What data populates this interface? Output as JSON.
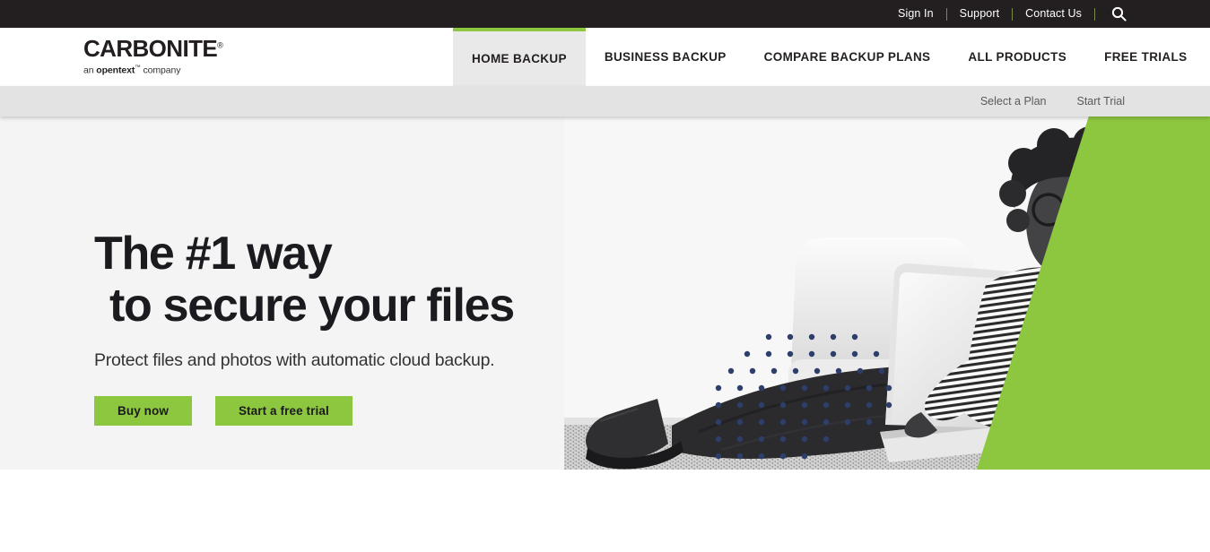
{
  "utility_bar": {
    "links": [
      {
        "label": "Sign In",
        "name": "sign-in-link"
      },
      {
        "label": "Support",
        "name": "support-link"
      },
      {
        "label": "Contact Us",
        "name": "contact-us-link"
      }
    ],
    "search_icon": "search-icon",
    "background_color": "#231f20",
    "separator_color": "#7b8a4a"
  },
  "logo": {
    "wordmark": "CARBONITE",
    "registered_mark": "®",
    "tagline_prefix": "an ",
    "tagline_brand": "opentext",
    "tagline_tm": "™",
    "tagline_suffix": " company"
  },
  "main_nav": {
    "items": [
      {
        "label": "HOME BACKUP",
        "name": "nav-home-backup",
        "active": true
      },
      {
        "label": "BUSINESS BACKUP",
        "name": "nav-business-backup",
        "active": false
      },
      {
        "label": "COMPARE BACKUP PLANS",
        "name": "nav-compare-backup-plans",
        "active": false
      },
      {
        "label": "ALL PRODUCTS",
        "name": "nav-all-products",
        "active": false
      },
      {
        "label": "FREE TRIALS",
        "name": "nav-free-trials",
        "active": false
      }
    ],
    "active_indicator_color": "#8dc63f",
    "active_background": "#e9e9e9"
  },
  "sub_nav": {
    "links": [
      {
        "label": "Select a Plan",
        "name": "select-a-plan-link"
      },
      {
        "label": "Start Trial",
        "name": "start-trial-link"
      }
    ],
    "background_color": "#e3e3e3"
  },
  "hero": {
    "title_line1": "The #1 way",
    "title_line2": "to secure your files",
    "subtitle": "Protect files and photos with automatic cloud backup.",
    "buttons": [
      {
        "label": "Buy now",
        "name": "buy-now-button"
      },
      {
        "label": "Start a free trial",
        "name": "start-a-free-trial-button"
      }
    ],
    "background_color": "#f4f4f4",
    "accent_color": "#8dc63f",
    "dot_color": "#2d3e6b",
    "image_description": "woman-with-laptop-photo"
  }
}
